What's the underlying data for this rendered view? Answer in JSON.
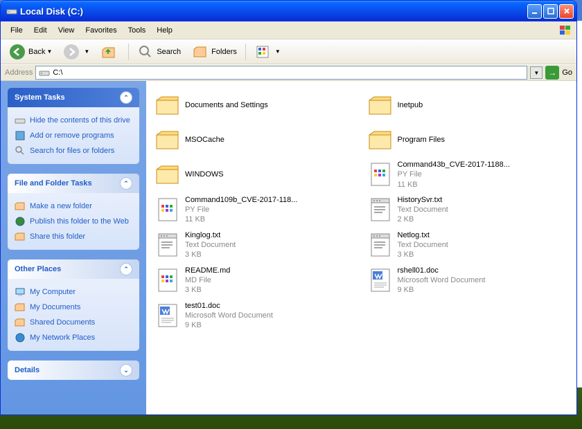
{
  "window": {
    "title": "Local Disk (C:)"
  },
  "menu": {
    "items": [
      "File",
      "Edit",
      "View",
      "Favorites",
      "Tools",
      "Help"
    ]
  },
  "toolbar": {
    "back": "Back",
    "search": "Search",
    "folders": "Folders"
  },
  "address": {
    "label": "Address",
    "value": "C:\\",
    "go": "Go"
  },
  "sidebar": {
    "system": {
      "title": "System Tasks",
      "items": [
        "Hide the contents of this drive",
        "Add or remove programs",
        "Search for files or folders"
      ]
    },
    "filefolder": {
      "title": "File and Folder Tasks",
      "items": [
        "Make a new folder",
        "Publish this folder to the Web",
        "Share this folder"
      ]
    },
    "other": {
      "title": "Other Places",
      "items": [
        "My Computer",
        "My Documents",
        "Shared Documents",
        "My Network Places"
      ]
    },
    "details": {
      "title": "Details"
    }
  },
  "files": [
    {
      "name": "Documents and Settings",
      "type": "folder",
      "meta1": "",
      "meta2": ""
    },
    {
      "name": "Inetpub",
      "type": "folder",
      "meta1": "",
      "meta2": ""
    },
    {
      "name": "MSOCache",
      "type": "folder",
      "meta1": "",
      "meta2": ""
    },
    {
      "name": "Program Files",
      "type": "folder",
      "meta1": "",
      "meta2": ""
    },
    {
      "name": "WINDOWS",
      "type": "folder",
      "meta1": "",
      "meta2": ""
    },
    {
      "name": "Command43b_CVE-2017-1188...",
      "type": "py",
      "meta1": "PY File",
      "meta2": "11 KB"
    },
    {
      "name": "Command109b_CVE-2017-118...",
      "type": "py",
      "meta1": "PY File",
      "meta2": "11 KB"
    },
    {
      "name": "HistorySvr.txt",
      "type": "txt",
      "meta1": "Text Document",
      "meta2": "2 KB"
    },
    {
      "name": "Kinglog.txt",
      "type": "txt",
      "meta1": "Text Document",
      "meta2": "3 KB"
    },
    {
      "name": "Netlog.txt",
      "type": "txt",
      "meta1": "Text Document",
      "meta2": "3 KB"
    },
    {
      "name": "README.md",
      "type": "py",
      "meta1": "MD File",
      "meta2": "3 KB"
    },
    {
      "name": "rshell01.doc",
      "type": "doc",
      "meta1": "Microsoft Word Document",
      "meta2": "9 KB"
    },
    {
      "name": "test01.doc",
      "type": "doc",
      "meta1": "Microsoft Word Document",
      "meta2": "9 KB"
    }
  ]
}
